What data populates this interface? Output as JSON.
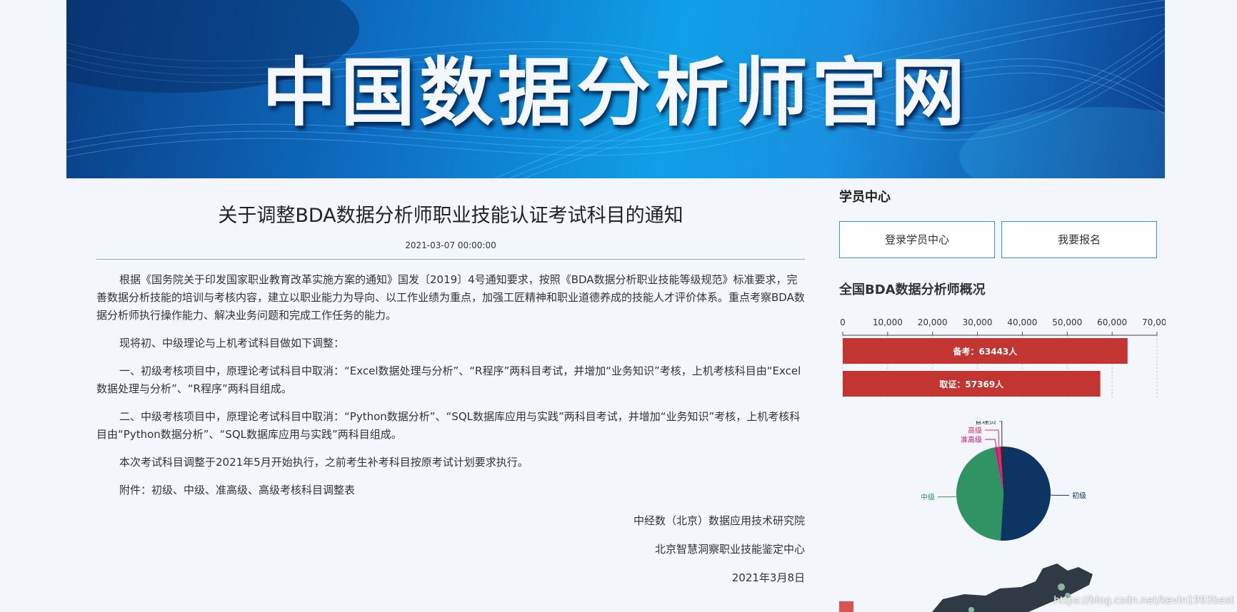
{
  "banner": {
    "title": "中国数据分析师官网"
  },
  "article": {
    "title": "关于调整BDA数据分析师职业技能认证考试科目的通知",
    "date": "2021-03-07 00:00:00",
    "paragraphs": [
      "根据《国务院关于印发国家职业教育改革实施方案的通知》国发〔2019〕4号通知要求，按照《BDA数据分析职业技能等级规范》标准要求，完善数据分析技能的培训与考核内容，建立以职业能力为导向、以工作业绩为重点，加强工匠精神和职业道德养成的技能人才评价体系。重点考察BDA数据分析师执行操作能力、解决业务问题和完成工作任务的能力。",
      "现将初、中级理论与上机考试科目做如下调整：",
      "一、初级考核项目中，原理论考试科目中取消：“Excel数据处理与分析”、“R程序”两科目考试，并增加“业务知识”考核，上机考核科目由“Excel数据处理与分析”、“R程序”两科目组成。",
      "二、中级考核项目中，原理论考试科目中取消：“Python数据分析”、“SQL数据库应用与实践”两科目考试，并增加“业务知识”考核，上机考核科目由“Python数据分析”、“SQL数据库应用与实践”两科目组成。",
      "本次考试科目调整于2021年5月开始执行，之前考生补考科目按原考试计划要求执行。",
      "附件：初级、中级、准高级、高级考核科目调整表"
    ],
    "signature": [
      "中经数（北京）数据应用技术研究院",
      "北京智慧洞察职业技能鉴定中心",
      "2021年3月8日"
    ]
  },
  "sidebar": {
    "student_center": "学员中心",
    "login_button": "登录学员中心",
    "signup_button": "我要报名",
    "overview_title": "全国BDA数据分析师概况"
  },
  "chart_data": [
    {
      "type": "bar",
      "orientation": "horizontal",
      "categories": [
        "备考",
        "取证"
      ],
      "values": [
        63443,
        57369
      ],
      "data_labels": [
        "备考：63443人",
        "取证：57369人"
      ],
      "xlim": [
        0,
        70000
      ],
      "xticks": [
        "0",
        "10,000",
        "20,000",
        "30,000",
        "40,000",
        "50,000",
        "60,000",
        "70,000"
      ],
      "xaxis_position": "top",
      "color": "#c23531"
    },
    {
      "type": "pie",
      "labels": [
        "初级",
        "中级",
        "准高级",
        "高级",
        "管理员"
      ],
      "values": [
        51,
        46,
        1,
        1,
        1
      ],
      "colors": [
        "#0d3563",
        "#2f9461",
        "#c71585",
        "#e0266e",
        "#2b2b2b"
      ]
    }
  ],
  "watermark": "https://blog.csdn.net/kevin1993best"
}
